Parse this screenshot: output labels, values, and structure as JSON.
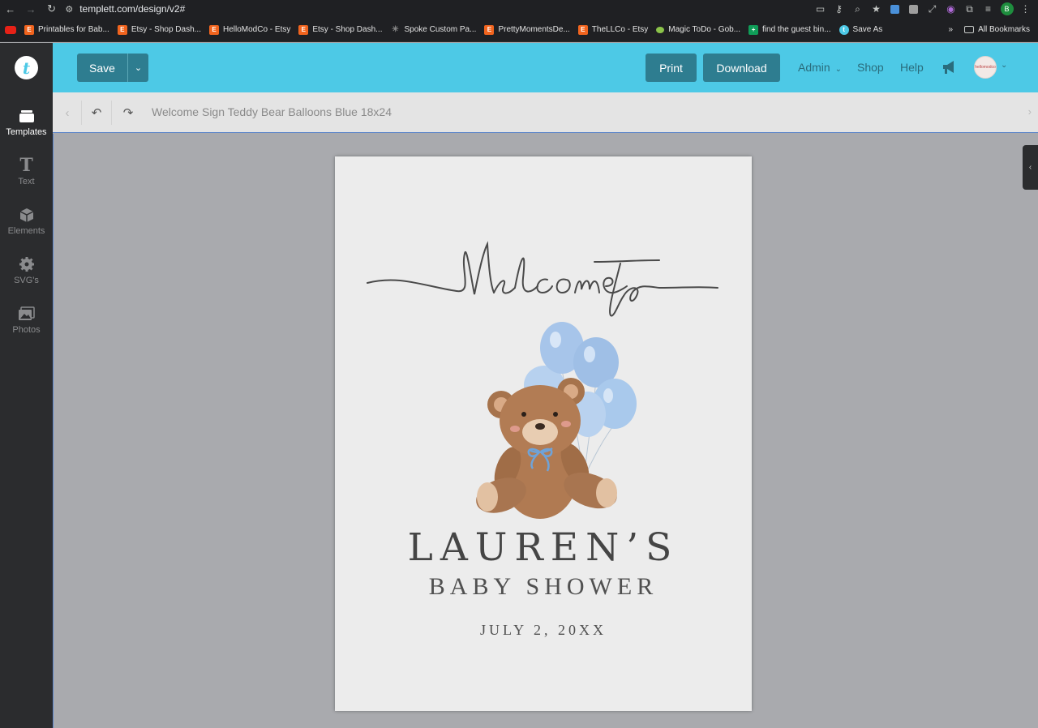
{
  "browser": {
    "url": "templett.com/design/v2#",
    "profile_initial": "B",
    "bookmarks": [
      {
        "label": "Printables for Bab..."
      },
      {
        "label": "Etsy - Shop Dash..."
      },
      {
        "label": "HelloModCo - Etsy"
      },
      {
        "label": "Etsy - Shop Dash..."
      },
      {
        "label": "Spoke Custom Pa..."
      },
      {
        "label": "PrettyMomentsDe..."
      },
      {
        "label": "TheLLCo - Etsy"
      },
      {
        "label": "Magic ToDo - Gob..."
      },
      {
        "label": "find the guest bin..."
      },
      {
        "label": "Save As"
      }
    ],
    "overflow": "»",
    "all_bookmarks": "All Bookmarks"
  },
  "app": {
    "logo_letter": "t",
    "rail": [
      {
        "label": "Templates"
      },
      {
        "label": "Text"
      },
      {
        "label": "Elements"
      },
      {
        "label": "SVG's"
      },
      {
        "label": "Photos"
      }
    ],
    "topbar": {
      "save_label": "Save",
      "print_label": "Print",
      "download_label": "Download",
      "admin_label": "Admin",
      "shop_label": "Shop",
      "help_label": "Help",
      "avatar_text": "hellomodco"
    },
    "toolbar": {
      "document_title": "Welcome Sign Teddy Bear Balloons Blue 18x24"
    }
  },
  "design": {
    "script_heading": "welcome to",
    "name": "LAUREN’S",
    "event": "BABY SHOWER",
    "date": "JULY 2, 20XX",
    "colors": {
      "balloon": "#a9c9ec",
      "bear": "#b07a52",
      "text": "#454545",
      "ribbon": "#6fa3d8"
    }
  }
}
